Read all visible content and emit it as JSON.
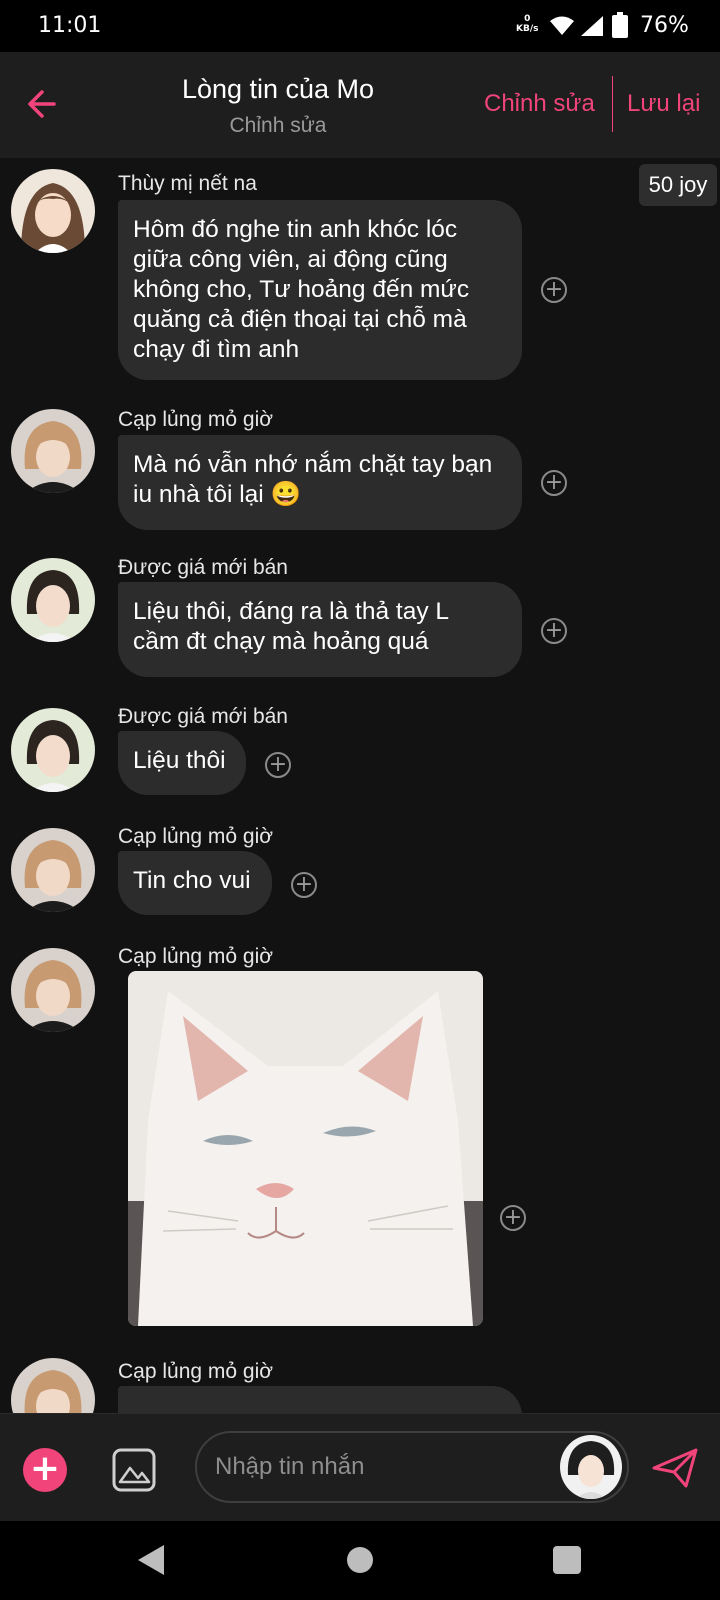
{
  "status_bar": {
    "time": "11:01",
    "net_speed_value": "0",
    "net_speed_unit": "KB/s",
    "battery": "76%"
  },
  "header": {
    "title": "Lòng tin của Mo",
    "subtitle": "Chỉnh sửa",
    "edit_label": "Chỉnh sửa",
    "save_label": "Lưu lại",
    "accent": "#f0447a"
  },
  "joy_badge": "50 joy",
  "messages": [
    {
      "sender": "Thùy mị nết na",
      "lines": [
        "Hôm đó nghe tin anh khóc lóc",
        "giữa công viên, ai động cũng",
        "không cho, Tư hoảng đến mức",
        "quăng cả điện thoại tại chỗ mà",
        "chạy đi tìm anh"
      ]
    },
    {
      "sender": "Cạp lủng mỏ giờ",
      "lines": [
        "Mà nó vẫn nhớ nắm chặt tay bạn",
        "iu nhà tôi lại 😀"
      ]
    },
    {
      "sender": "Được giá mới bán",
      "lines": [
        "Liệu thôi, đáng ra là thả tay L",
        "cầm đt chạy mà hoảng quá"
      ]
    },
    {
      "sender": "Được giá mới bán",
      "lines": [
        "Liệu thôi"
      ]
    },
    {
      "sender": "Cạp lủng mỏ giờ",
      "lines": [
        "Tin cho vui"
      ]
    },
    {
      "sender": "Cạp lủng mỏ giờ",
      "image": "white-cat-photo"
    },
    {
      "sender": "Cạp lủng mỏ giờ"
    }
  ],
  "input": {
    "placeholder": "Nhập tin nhắn"
  },
  "icons": {
    "back": "arrow-left-icon",
    "add": "plus-icon",
    "gallery": "image-icon",
    "send": "send-icon",
    "react": "add-circle-icon"
  }
}
